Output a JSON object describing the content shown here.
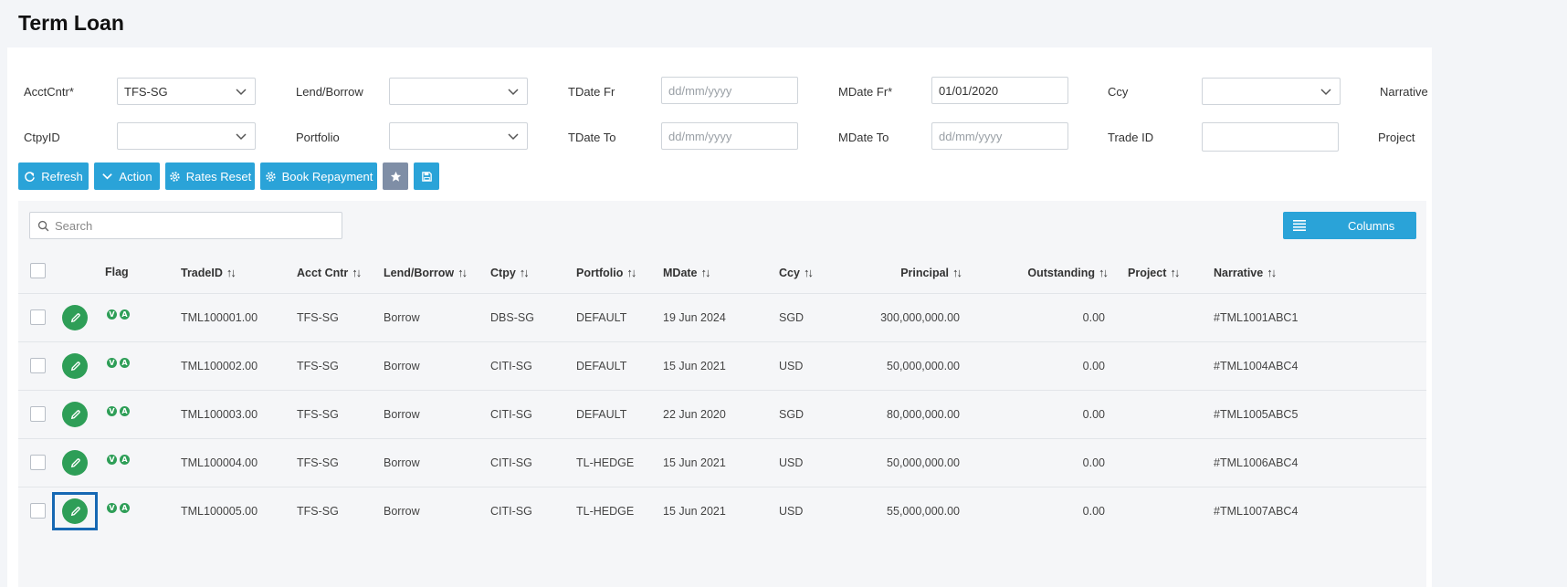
{
  "page_title": "Term Loan",
  "filters": {
    "acctcntr_label": "AcctCntr*",
    "acctcntr_value": "TFS-SG",
    "lend_borrow_label": "Lend/Borrow",
    "lend_borrow_value": "",
    "tdate_fr_label": "TDate Fr",
    "tdate_fr_placeholder": "dd/mm/yyyy",
    "mdate_fr_label": "MDate Fr*",
    "mdate_fr_value": "01/01/2020",
    "ccy_label": "Ccy",
    "ccy_value": "",
    "narrative_label": "Narrative",
    "ctpyid_label": "CtpyID",
    "ctpyid_value": "",
    "portfolio_label": "Portfolio",
    "portfolio_value": "",
    "tdate_to_label": "TDate To",
    "tdate_to_placeholder": "dd/mm/yyyy",
    "mdate_to_label": "MDate To",
    "mdate_to_placeholder": "dd/mm/yyyy",
    "trade_id_label": "Trade ID",
    "trade_id_value": "",
    "project_label": "Project"
  },
  "toolbar": {
    "refresh_label": "Refresh",
    "action_label": "Action",
    "rates_reset_label": "Rates Reset",
    "book_repayment_label": "Book Repayment"
  },
  "grid": {
    "search_placeholder": "Search",
    "columns_button_label": "Columns",
    "headers": {
      "flag": "Flag",
      "tradeid": "TradeID",
      "acct_cntr": "Acct Cntr",
      "lend_borrow": "Lend/Borrow",
      "ctpy": "Ctpy",
      "portfolio": "Portfolio",
      "mdate": "MDate",
      "ccy": "Ccy",
      "principal": "Principal",
      "outstanding": "Outstanding",
      "project": "Project",
      "narrative": "Narrative"
    },
    "sort_glyph": "↑↓",
    "flag_letters": [
      "V",
      "A"
    ],
    "rows": [
      {
        "tradeid": "TML100001.00",
        "acct_cntr": "TFS-SG",
        "lend_borrow": "Borrow",
        "ctpy": "DBS-SG",
        "portfolio": "DEFAULT",
        "mdate": "19 Jun 2024",
        "ccy": "SGD",
        "principal": "300,000,000.00",
        "outstanding": "0.00",
        "project": "",
        "narrative": "#TML1001ABC1"
      },
      {
        "tradeid": "TML100002.00",
        "acct_cntr": "TFS-SG",
        "lend_borrow": "Borrow",
        "ctpy": "CITI-SG",
        "portfolio": "DEFAULT",
        "mdate": "15 Jun 2021",
        "ccy": "USD",
        "principal": "50,000,000.00",
        "outstanding": "0.00",
        "project": "",
        "narrative": "#TML1004ABC4"
      },
      {
        "tradeid": "TML100003.00",
        "acct_cntr": "TFS-SG",
        "lend_borrow": "Borrow",
        "ctpy": "CITI-SG",
        "portfolio": "DEFAULT",
        "mdate": "22 Jun 2020",
        "ccy": "SGD",
        "principal": "80,000,000.00",
        "outstanding": "0.00",
        "project": "",
        "narrative": "#TML1005ABC5"
      },
      {
        "tradeid": "TML100004.00",
        "acct_cntr": "TFS-SG",
        "lend_borrow": "Borrow",
        "ctpy": "CITI-SG",
        "portfolio": "TL-HEDGE",
        "mdate": "15 Jun 2021",
        "ccy": "USD",
        "principal": "50,000,000.00",
        "outstanding": "0.00",
        "project": "",
        "narrative": "#TML1006ABC4"
      },
      {
        "tradeid": "TML100005.00",
        "acct_cntr": "TFS-SG",
        "lend_borrow": "Borrow",
        "ctpy": "CITI-SG",
        "portfolio": "TL-HEDGE",
        "mdate": "15 Jun 2021",
        "ccy": "USD",
        "principal": "55,000,000.00",
        "outstanding": "0.00",
        "project": "",
        "narrative": "#TML1007ABC4"
      }
    ]
  },
  "colors": {
    "primary_button": "#2aa3d8",
    "edit_button": "#2e9e57",
    "icon_button_gray": "#7f8ea6",
    "highlight_border": "#1668b3"
  },
  "icons": {
    "refresh": "refresh-icon",
    "action": "chevron-down-icon",
    "rates_reset": "gear-icon",
    "book_repayment": "gear-icon",
    "favorite": "star-icon",
    "save": "save-icon",
    "search": "search-icon",
    "columns": "list-icon",
    "edit": "pencil-icon"
  }
}
